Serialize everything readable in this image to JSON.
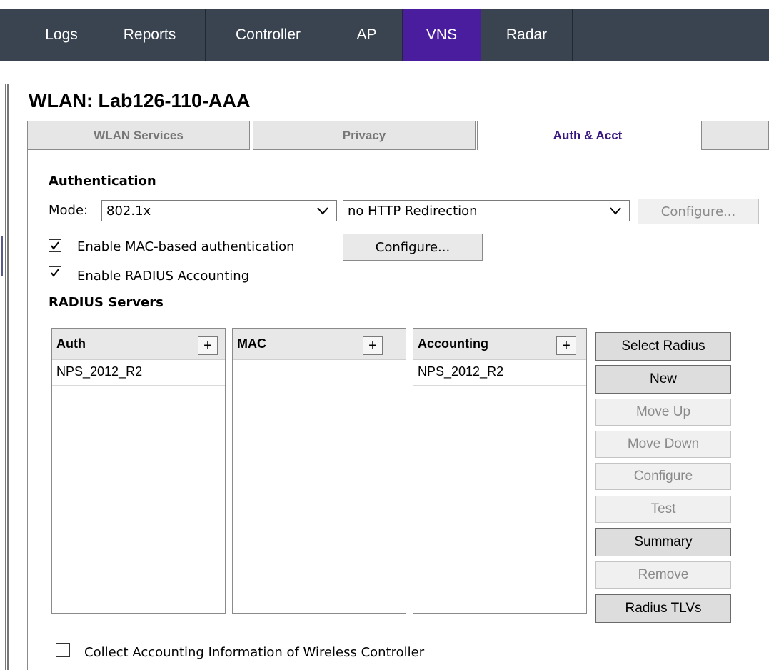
{
  "nav": {
    "tabs": [
      {
        "label": "Logs"
      },
      {
        "label": "Reports"
      },
      {
        "label": "Controller"
      },
      {
        "label": "AP"
      },
      {
        "label": "VNS"
      },
      {
        "label": "Radar"
      }
    ],
    "active": "VNS"
  },
  "page": {
    "title": "WLAN: Lab126-110-AAA"
  },
  "subtabs": [
    {
      "label": "WLAN Services"
    },
    {
      "label": "Privacy"
    },
    {
      "label": "Auth & Acct"
    },
    {
      "label": ""
    }
  ],
  "authentication": {
    "heading": "Authentication",
    "mode_label": "Mode:",
    "mode_value": "802.1x",
    "redirection_value": "no HTTP Redirection",
    "configure_label": "Configure...",
    "mac_auth_label": "Enable MAC-based authentication",
    "mac_auth_checked": true,
    "mac_configure_label": "Configure...",
    "radius_accounting_label": "Enable RADIUS Accounting",
    "radius_accounting_checked": true
  },
  "radius": {
    "heading": "RADIUS Servers",
    "lists": [
      {
        "header": "Auth",
        "plus": "+",
        "rows": [
          "NPS_2012_R2"
        ]
      },
      {
        "header": "MAC",
        "plus": "+",
        "rows": []
      },
      {
        "header": "Accounting",
        "plus": "+",
        "rows": [
          "NPS_2012_R2"
        ]
      }
    ],
    "buttons": {
      "select_radius": "Select Radius",
      "new": "New",
      "move_up": "Move Up",
      "move_down": "Move Down",
      "configure": "Configure",
      "test": "Test",
      "summary": "Summary",
      "remove": "Remove",
      "radius_tlvs": "Radius TLVs"
    }
  },
  "collect_accounting": {
    "label": "Collect Accounting Information of Wireless Controller",
    "checked": false
  },
  "colors": {
    "nav_bg": "#3a4350",
    "nav_active": "#4a1d9e",
    "active_tab_text": "#3a1a80"
  }
}
